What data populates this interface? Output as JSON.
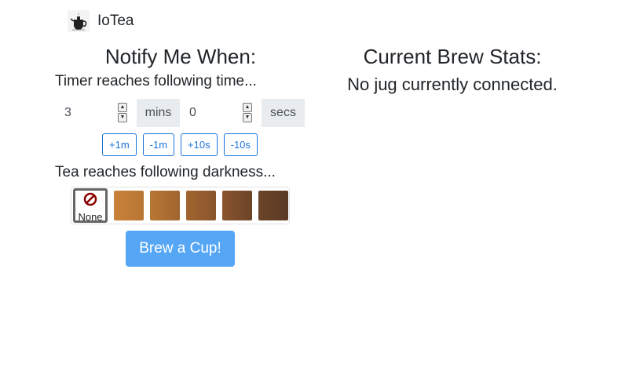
{
  "brand": {
    "name": "IoTea",
    "logo_icon": "teapot-icon"
  },
  "notify": {
    "title": "Notify Me When:",
    "timer_label": "Timer reaches following time...",
    "minutes": {
      "value": "3",
      "unit": "mins"
    },
    "seconds": {
      "value": "0",
      "unit": "secs"
    },
    "adjust_buttons": [
      "+1m",
      "-1m",
      "+10s",
      "-10s"
    ],
    "darkness_label": "Tea reaches following darkness...",
    "darkness_options": {
      "none_label": "None",
      "none_icon": "prohibited-icon",
      "selected": "None",
      "colors": [
        "#c9823a",
        "#b87633",
        "#a1652f",
        "#8a552d",
        "#6b4428"
      ]
    },
    "brew_button": "Brew a Cup!"
  },
  "stats": {
    "title": "Current Brew Stats:",
    "message": "No jug currently connected."
  },
  "colors": {
    "primary": "#1a73d9",
    "brew_button": "#56a6f6",
    "none_icon": "#8b0000"
  }
}
